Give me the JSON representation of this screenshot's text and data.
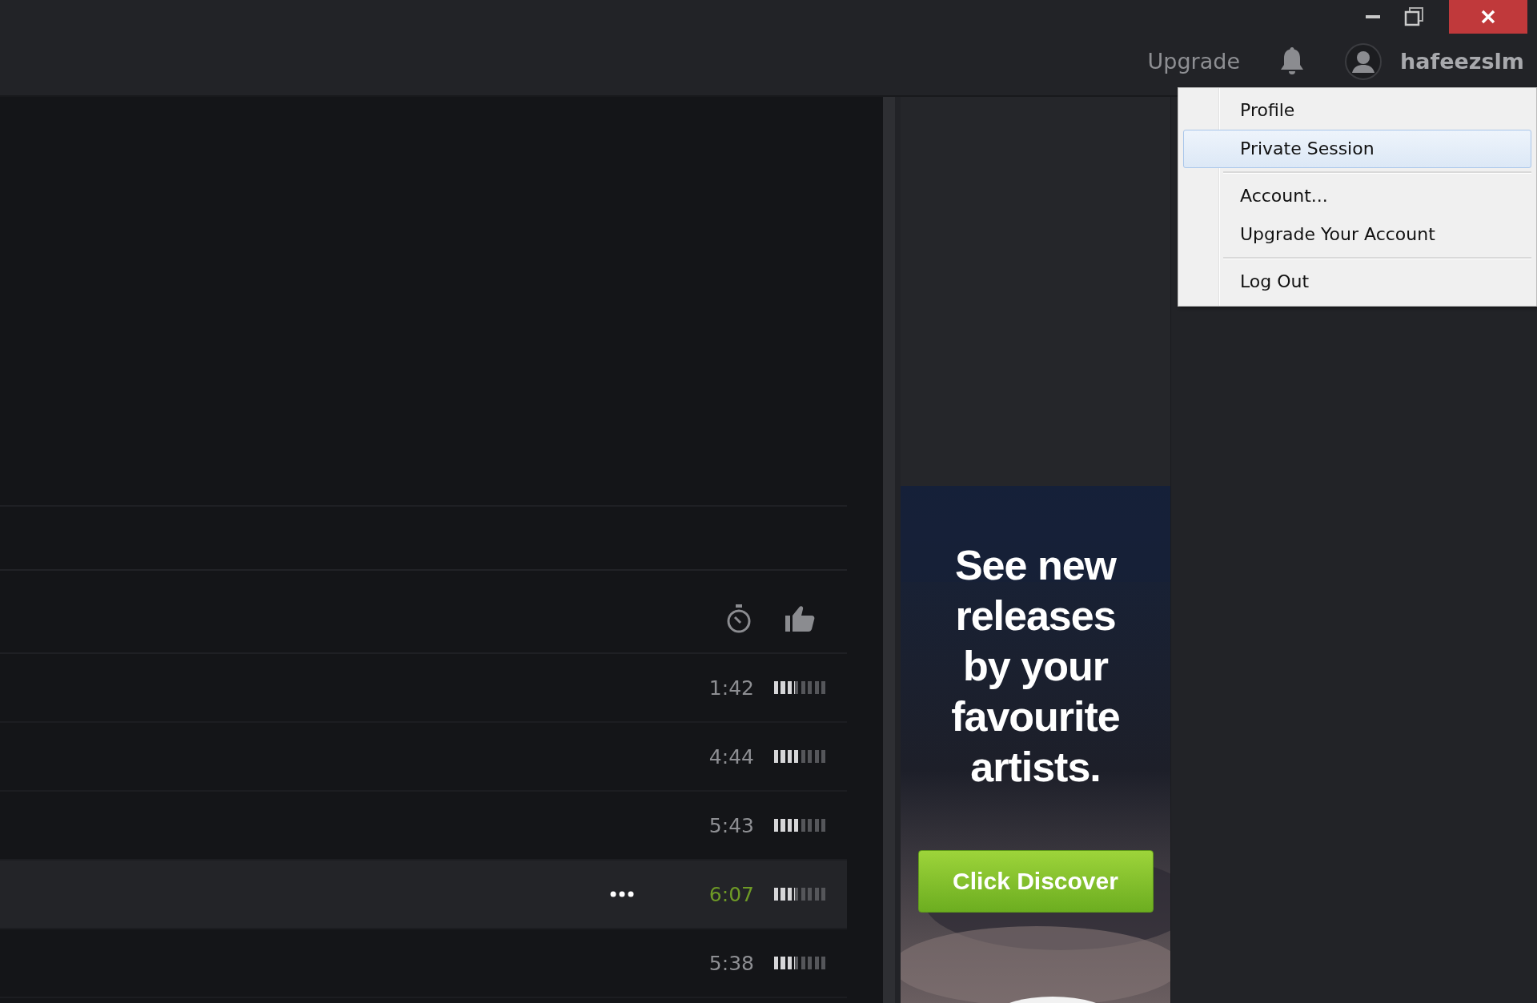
{
  "top_bar": {
    "upgrade_link": "Upgrade",
    "username": "hafeezslm"
  },
  "account_menu": {
    "items": [
      {
        "label": "Profile",
        "selected": false,
        "separator_after": false
      },
      {
        "label": "Private Session",
        "selected": true,
        "separator_after": true
      },
      {
        "label": "Account...",
        "selected": false,
        "separator_after": false
      },
      {
        "label": "Upgrade Your Account",
        "selected": false,
        "separator_after": true
      },
      {
        "label": "Log Out",
        "selected": false,
        "separator_after": false
      }
    ]
  },
  "tracks": [
    {
      "duration": "1:42",
      "level": 0.375,
      "selected": false
    },
    {
      "duration": "4:44",
      "level": 0.5,
      "selected": false
    },
    {
      "duration": "5:43",
      "level": 0.5,
      "selected": false
    },
    {
      "duration": "6:07",
      "level": 0.375,
      "selected": true
    },
    {
      "duration": "5:38",
      "level": 0.375,
      "selected": false
    }
  ],
  "ad": {
    "headline": "See new releases by your favourite artists.",
    "button": "Click Discover",
    "kind": "picture"
  }
}
